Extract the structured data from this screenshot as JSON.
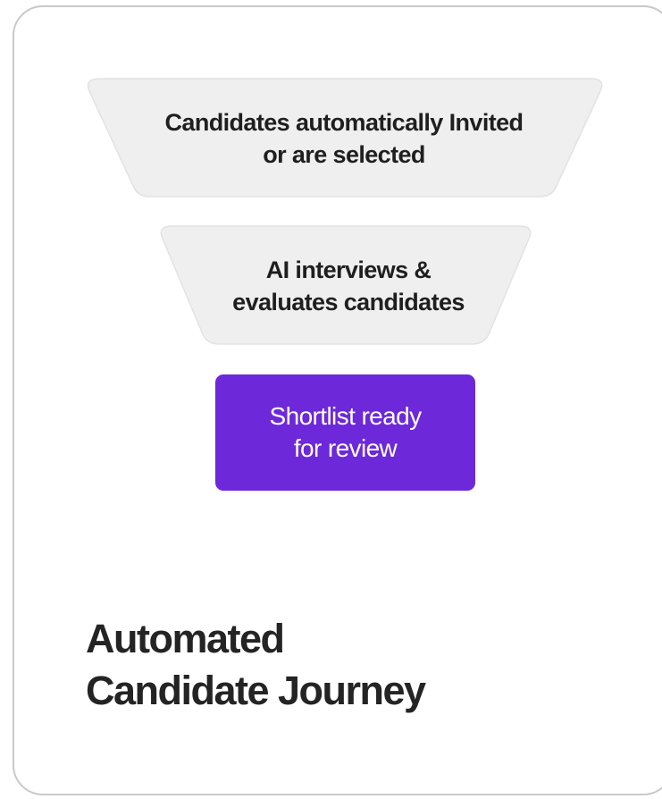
{
  "funnel": {
    "stages": [
      {
        "lines": [
          "Candidates automatically Invited",
          "or are selected"
        ]
      },
      {
        "lines": [
          "AI interviews &",
          "evaluates candidates"
        ]
      },
      {
        "lines": [
          "Shortlist ready",
          "for review"
        ]
      }
    ],
    "colors": {
      "stage_fill": "#efefef",
      "stage_border": "#e2e2e2",
      "highlight_fill": "#6d28d9",
      "highlight_text": "#ffffff"
    }
  },
  "title": {
    "line1": "Automated",
    "line2": "Candidate Journey"
  }
}
